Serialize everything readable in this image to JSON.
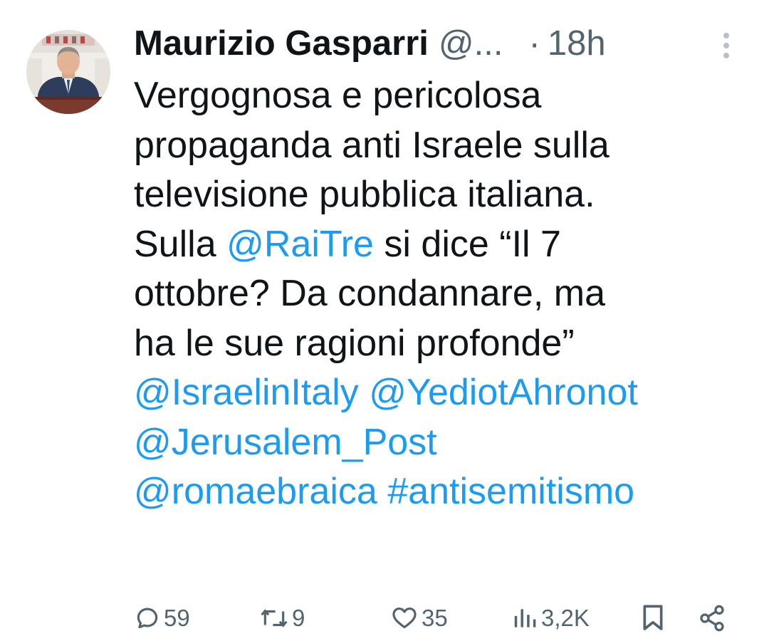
{
  "author": {
    "display_name": "Maurizio Gasparri",
    "handle": "@...",
    "separator": "·",
    "time": "18h",
    "avatar": "profile-photo"
  },
  "tweet": {
    "lines": [
      [
        {
          "text": "Vergognosa e pericolosa",
          "link": false
        }
      ],
      [
        {
          "text": "propaganda anti Israele sulla",
          "link": false
        }
      ],
      [
        {
          "text": "televisione pubblica italiana.",
          "link": false
        }
      ],
      [
        {
          "text": "Sulla ",
          "link": false
        },
        {
          "text": "@RaiTre",
          "link": true
        },
        {
          "text": " si dice “Il 7",
          "link": false
        }
      ],
      [
        {
          "text": "ottobre? Da condannare, ma",
          "link": false
        }
      ],
      [
        {
          "text": "ha le sue ragioni profonde”",
          "link": false
        }
      ],
      [
        {
          "text": "@IsraelinItaly",
          "link": true
        },
        {
          "text": " ",
          "link": false
        },
        {
          "text": "@YediotAhronot",
          "link": true
        }
      ],
      [
        {
          "text": "@Jerusalem_Post",
          "link": true
        }
      ],
      [
        {
          "text": "@romaebraica",
          "link": true
        },
        {
          "text": " ",
          "link": false
        },
        {
          "text": "#antisemitismo",
          "link": true
        }
      ]
    ]
  },
  "actions": {
    "replies": {
      "icon": "reply-icon",
      "count": "59"
    },
    "reposts": {
      "icon": "repost-icon",
      "count": "9"
    },
    "likes": {
      "icon": "like-icon",
      "count": "35"
    },
    "views": {
      "icon": "views-icon",
      "count": "3,2K"
    },
    "bookmark": {
      "icon": "bookmark-icon"
    },
    "share": {
      "icon": "share-icon"
    }
  },
  "colors": {
    "text": "#0f1419",
    "secondary": "#536471",
    "link": "#1d9bf0",
    "background": "#ffffff"
  }
}
